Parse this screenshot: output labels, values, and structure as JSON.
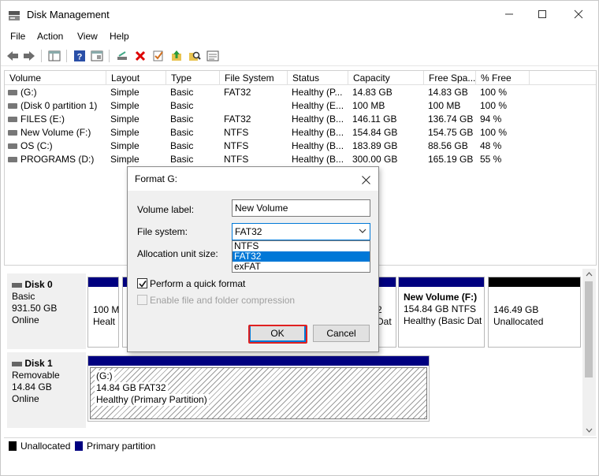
{
  "window": {
    "title": "Disk Management"
  },
  "menu": [
    "File",
    "Action",
    "View",
    "Help"
  ],
  "volume_list": {
    "columns": [
      "Volume",
      "Layout",
      "Type",
      "File System",
      "Status",
      "Capacity",
      "Free Spa...",
      "% Free"
    ],
    "rows": [
      [
        "(G:)",
        "Simple",
        "Basic",
        "FAT32",
        "Healthy (P...",
        "14.83 GB",
        "14.83 GB",
        "100 %"
      ],
      [
        "(Disk 0 partition 1)",
        "Simple",
        "Basic",
        "",
        "Healthy (E...",
        "100 MB",
        "100 MB",
        "100 %"
      ],
      [
        "FILES (E:)",
        "Simple",
        "Basic",
        "FAT32",
        "Healthy (B...",
        "146.11 GB",
        "136.74 GB",
        "94 %"
      ],
      [
        "New Volume (F:)",
        "Simple",
        "Basic",
        "NTFS",
        "Healthy (B...",
        "154.84 GB",
        "154.75 GB",
        "100 %"
      ],
      [
        "OS (C:)",
        "Simple",
        "Basic",
        "NTFS",
        "Healthy (B...",
        "183.89 GB",
        "88.56 GB",
        "48 %"
      ],
      [
        "PROGRAMS (D:)",
        "Simple",
        "Basic",
        "NTFS",
        "Healthy (B...",
        "300.00 GB",
        "165.19 GB",
        "55 %"
      ]
    ]
  },
  "disks": {
    "disk0": {
      "name": "Disk 0",
      "type": "Basic",
      "size": "931.50 GB",
      "status": "Online",
      "part1": {
        "line1": "100 M",
        "line2": "Healt"
      },
      "part_mid": {
        "line1": "2",
        "line2": "Dat"
      },
      "part_newvol": {
        "name": "New Volume  (F:)",
        "line1": "154.84 GB NTFS",
        "line2": "Healthy (Basic Dat"
      },
      "part_unalloc": {
        "line1": "146.49 GB",
        "line2": "Unallocated"
      }
    },
    "disk1": {
      "name": "Disk 1",
      "type": "Removable",
      "size": "14.84 GB",
      "status": "Online",
      "part": {
        "name": "(G:)",
        "line1": "14.84 GB FAT32",
        "line2": "Healthy (Primary Partition)"
      }
    }
  },
  "legend": {
    "unallocated": "Unallocated",
    "primary": "Primary partition"
  },
  "colors": {
    "primary_bar": "#000080",
    "unallocated": "#000000",
    "accent": "#0078d7",
    "highlight": "#e02020"
  },
  "dialog": {
    "title": "Format G:",
    "volume_label_label": "Volume label:",
    "volume_label_value": "New Volume",
    "file_system_label": "File system:",
    "file_system_value": "FAT32",
    "file_system_options": [
      "NTFS",
      "FAT32",
      "exFAT"
    ],
    "allocation_label": "Allocation unit size:",
    "quick_format_label": "Perform a quick format",
    "quick_format_checked": true,
    "compression_label": "Enable file and folder compression",
    "compression_checked": false,
    "ok_label": "OK",
    "cancel_label": "Cancel"
  }
}
